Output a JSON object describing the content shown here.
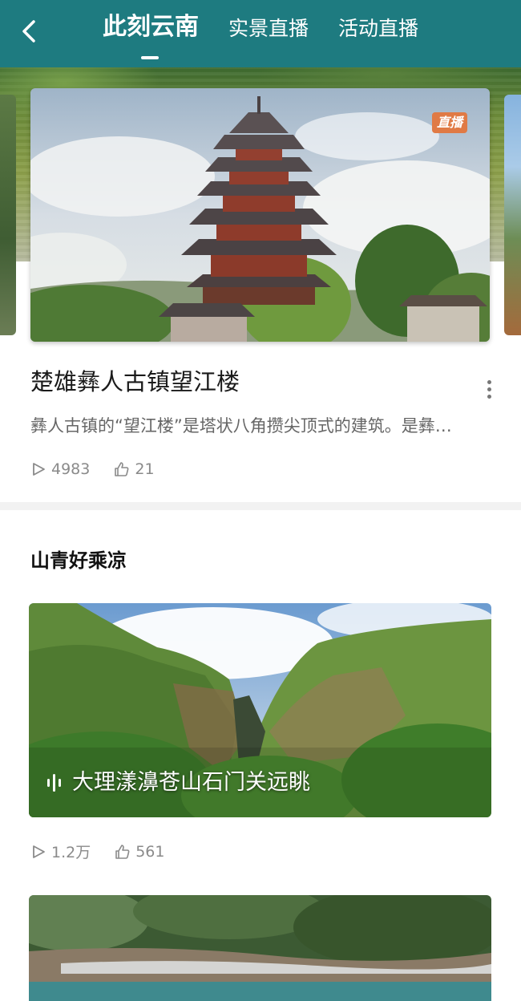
{
  "header": {
    "tabs": [
      {
        "label": "此刻云南",
        "active": true
      },
      {
        "label": "实景直播",
        "active": false
      },
      {
        "label": "活动直播",
        "active": false
      }
    ],
    "back_icon": "chevron-left-icon",
    "background_color": "#1e7b80"
  },
  "featured": {
    "badge": "直播",
    "title": "楚雄彝人古镇望江楼",
    "description": "彝人古镇的“望江楼”是塔状八角攒尖顶式的建筑。是彝…",
    "views": "4983",
    "likes": "21"
  },
  "section": {
    "title": "山青好乘凉",
    "items": [
      {
        "caption": "大理漾濞苍山石门关远眺",
        "views": "1.2万",
        "likes": "561"
      }
    ]
  },
  "colors": {
    "accent": "#1e7b80",
    "live_badge": "#e07a45"
  }
}
